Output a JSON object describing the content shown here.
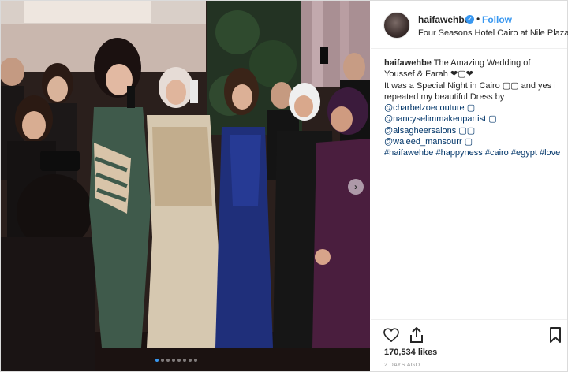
{
  "post": {
    "username": "haifawehbe",
    "verified": true,
    "follow_label": "Follow",
    "separator": "•",
    "location": "Four Seasons Hotel Cairo at Nile Plaza",
    "avatar_icon": "profile-avatar",
    "caption": {
      "username": "haifawehbe",
      "line1": "The Amazing Wedding of",
      "line2": "Youssef & Farah ❤︎▢❤︎",
      "line3": "It was a Special Night in Cairo ▢▢ and yes i",
      "line4": "repeated my beautiful Dress by",
      "mentions": [
        "@charbelzoecouture ▢",
        "@nancyselimmakeupartist ▢",
        "@alsagheersalons ▢▢",
        "@waleed_mansourr ▢"
      ],
      "hashtags": [
        "#haifawehbe",
        "#happyness",
        "#cairo",
        "#egypt",
        "#love"
      ]
    },
    "likes_text": "170,534 likes",
    "timestamp": "2 DAYS AGO",
    "next_button": "›",
    "carousel": {
      "count": 8,
      "active_index": 0
    }
  },
  "colors": {
    "link": "#003569",
    "follow": "#3897f0",
    "text": "#262626",
    "muted": "#999999"
  }
}
